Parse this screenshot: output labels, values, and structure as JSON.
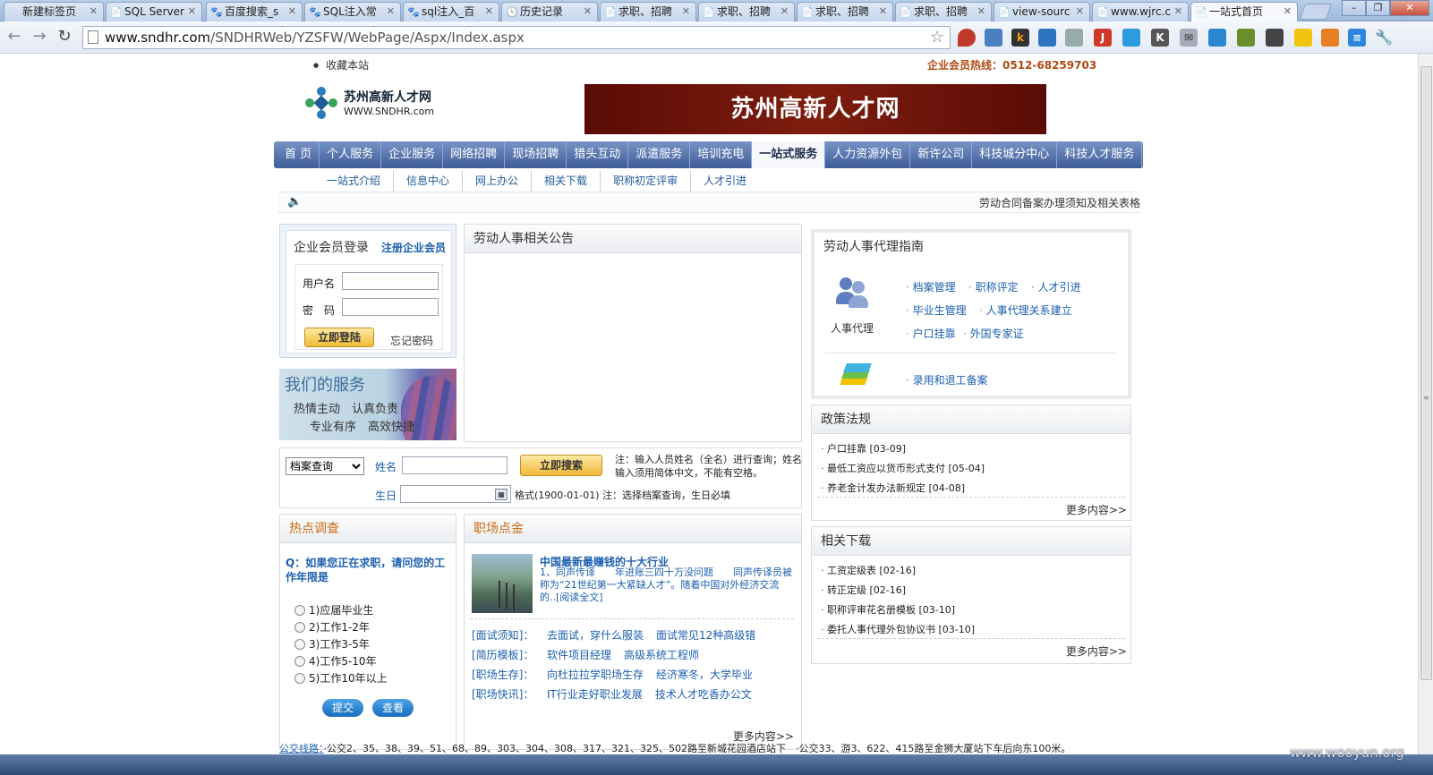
{
  "browser": {
    "tabs": [
      {
        "label": "新建标签页",
        "icon": ""
      },
      {
        "label": "SQL Server",
        "icon": "📄"
      },
      {
        "label": "百度搜索_s",
        "icon": "🐾"
      },
      {
        "label": "SQL注入常",
        "icon": "🐾"
      },
      {
        "label": "sql注入_百",
        "icon": "🐾"
      },
      {
        "label": "历史记录",
        "icon": "🕓"
      },
      {
        "label": "求职、招聘",
        "icon": "📄"
      },
      {
        "label": "求职、招聘",
        "icon": "📄"
      },
      {
        "label": "求职、招聘",
        "icon": "📄"
      },
      {
        "label": "求职、招聘",
        "icon": "📄"
      },
      {
        "label": "view-sourc",
        "icon": "📄"
      },
      {
        "label": "www.wjrc.c",
        "icon": "📄"
      },
      {
        "label": "一站式首页",
        "icon": "📄",
        "active": true
      }
    ],
    "url_host": "www.sndhr.com",
    "url_path": "/SNDHRWeb/YZSFW/WebPage/Aspx/Index.aspx",
    "watermark": "www.wooyun.org"
  },
  "site": {
    "favorite": "收藏本站",
    "hotline": "企业会员热线：0512-68259703",
    "logo_cn": "苏州高新人才网",
    "logo_en": "WWW.SNDHR.com",
    "banner": "苏州高新人才网"
  },
  "main_nav": [
    "首 页",
    "个人服务",
    "企业服务",
    "网络招聘",
    "现场招聘",
    "猎头互动",
    "派遣服务",
    "培训充电",
    "一站式服务",
    "人力资源外包",
    "新许公司",
    "科技城分中心",
    "科技人才服务"
  ],
  "main_nav_active": 8,
  "sub_nav": [
    "一站式介绍",
    "信息中心",
    "网上办公",
    "相关下载",
    "职称初定评审",
    "人才引进"
  ],
  "marquee": "劳动合同备案办理须知及相关表格",
  "login": {
    "title": "企业会员登录",
    "register": "注册企业会员",
    "username_label": "用户名",
    "password_label": "密　码",
    "submit": "立即登陆",
    "forgot": "忘记密码"
  },
  "services": {
    "title": "我们的服务",
    "line1": "热情主动　认真负责",
    "line2": "专业有序　高效快捷"
  },
  "notice": {
    "title": "劳动人事相关公告"
  },
  "search": {
    "select": "档案查询",
    "name_label": "姓名",
    "birthday_label": "生日",
    "button": "立即搜索",
    "note": "注：输入人员姓名（全名）进行查询；姓名输入须用简体中文，不能有空格。",
    "format_note": "格式(1900-01-01) 注：选择档案查询，生日必填"
  },
  "survey": {
    "title": "热点调查",
    "question": "Q：如果您正在求职，请问您的工作年限是",
    "options": [
      "1)应届毕业生",
      "2)工作1-2年",
      "3)工作3-5年",
      "4)工作5-10年",
      "5)工作10年以上"
    ],
    "submit": "提交",
    "view": "查看"
  },
  "career": {
    "title": "职场点金",
    "headline": "中国最新最赚钱的十大行业",
    "summary": "1、同声传译　　年进账三四十万没问题　　同声传译员被称为“21世纪第一大紧缺人才”。随着中国对外经济交流的..[阅读全文]",
    "rows": [
      {
        "cat": "[面试须知]：",
        "links": [
          "去面试，穿什么服装",
          "面试常见12种高级错"
        ]
      },
      {
        "cat": "[简历模板]：",
        "links": [
          "软件项目经理",
          "高级系统工程师"
        ]
      },
      {
        "cat": "[职场生存]：",
        "links": [
          "向杜拉拉学职场生存",
          "经济寒冬，大学毕业"
        ]
      },
      {
        "cat": "[职场快讯]：",
        "links": [
          "IT行业走好职业发展",
          "技术人才吃香办公文"
        ]
      }
    ],
    "more": "更多内容>>"
  },
  "guide": {
    "title": "劳动人事代理指南",
    "caption": "人事代理",
    "links": [
      "档案管理",
      "职称评定",
      "人才引进",
      "毕业生管理",
      "人事代理关系建立",
      "户口挂靠",
      "外国专家证"
    ],
    "link2": "录用和退工备案"
  },
  "policy": {
    "title": "政策法规",
    "items": [
      "户口挂靠 [03-09]",
      "最低工资应以货币形式支付 [05-04]",
      "养老金计发办法新规定 [04-08]"
    ],
    "more": "更多内容>>"
  },
  "download": {
    "title": "相关下载",
    "items": [
      "工资定级表 [02-16]",
      "转正定级 [02-16]",
      "职称评审花名册模板 [03-10]",
      "委托人事代理外包协议书 [03-10]"
    ],
    "more": "更多内容>>"
  },
  "bus": {
    "label": "公交线路：",
    "text": "·公交2、35、38、39、51、68、89、303、304、308、317、321、325、502路至新城花园酒店站下　·公交33、游3、622、415路至金狮大厦站下车后向东100米。"
  }
}
